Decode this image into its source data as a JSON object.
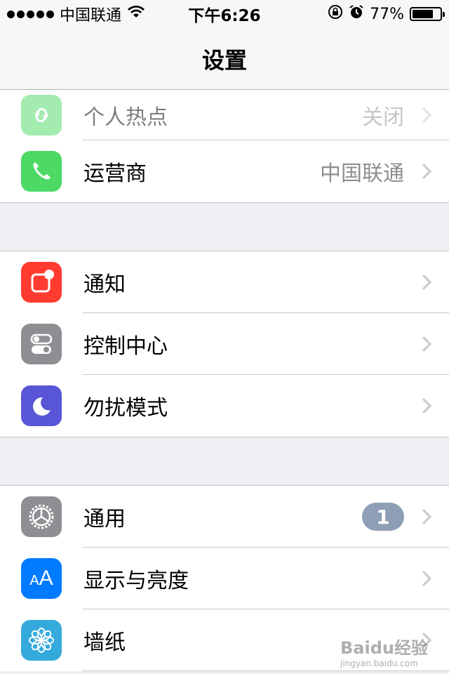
{
  "status_bar": {
    "carrier": "中国联通",
    "time": "下午6:26",
    "battery": "77%",
    "battery_level": 0.77,
    "icons": [
      "signal-dots-icon",
      "wifi-icon",
      "rotation-lock-icon",
      "alarm-icon",
      "battery-icon"
    ]
  },
  "nav": {
    "title": "设置"
  },
  "groups": [
    {
      "rows": [
        {
          "label": "个人热点",
          "value": "关闭",
          "icon": "hotspot-icon",
          "color": "#4cd964"
        },
        {
          "label": "运营商",
          "value": "中国联通",
          "icon": "phone-icon",
          "color": "#4cd964"
        }
      ]
    },
    {
      "rows": [
        {
          "label": "通知",
          "icon": "notifications-icon",
          "color": "#ff3b30"
        },
        {
          "label": "控制中心",
          "icon": "control-center-icon",
          "color": "#8e8e93"
        },
        {
          "label": "勿扰模式",
          "icon": "moon-icon",
          "color": "#5856d6"
        }
      ]
    },
    {
      "rows": [
        {
          "label": "通用",
          "badge": "1",
          "icon": "gear-icon",
          "color": "#8e8e93"
        },
        {
          "label": "显示与亮度",
          "icon": "display-aa-icon",
          "color": "#007aff",
          "icon_text": "AA"
        },
        {
          "label": "墙纸",
          "icon": "wallpaper-flower-icon",
          "color": "#34aadc"
        }
      ]
    }
  ],
  "watermark": {
    "brand": "Baidu经验",
    "url": "jingyan.baidu.com"
  },
  "colors": {
    "accent": "#007aff",
    "badge": "#8e9eb5",
    "separator": "#c8c7cc",
    "background": "#efeff4"
  }
}
